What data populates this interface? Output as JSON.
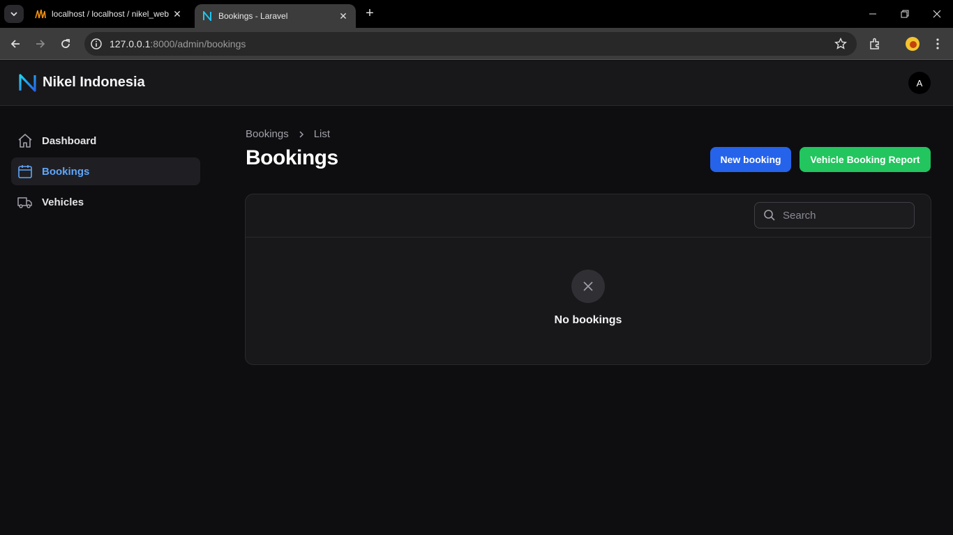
{
  "browser": {
    "tabs": [
      {
        "title": "localhost / localhost / nikel_web",
        "favicon": "phpmyadmin-icon"
      },
      {
        "title": "Bookings - Laravel",
        "favicon": "nikel-logo-icon"
      }
    ],
    "url_host": "127.0.0.1",
    "url_path": ":8000/admin/bookings"
  },
  "app": {
    "brand": "Nikel Indonesia",
    "avatar_initial": "A",
    "accent": "#60a5fa"
  },
  "sidebar": {
    "items": [
      {
        "label": "Dashboard",
        "icon": "home-icon"
      },
      {
        "label": "Bookings",
        "icon": "calendar-icon",
        "active": true
      },
      {
        "label": "Vehicles",
        "icon": "truck-icon"
      }
    ]
  },
  "breadcrumb": {
    "items": [
      "Bookings",
      "List"
    ]
  },
  "page": {
    "title": "Bookings"
  },
  "actions": {
    "new_booking": "New booking",
    "report": "Vehicle Booking Report",
    "new_color": "#2563eb",
    "report_color": "#22c55e"
  },
  "table": {
    "search_placeholder": "Search",
    "empty_text": "No bookings"
  }
}
